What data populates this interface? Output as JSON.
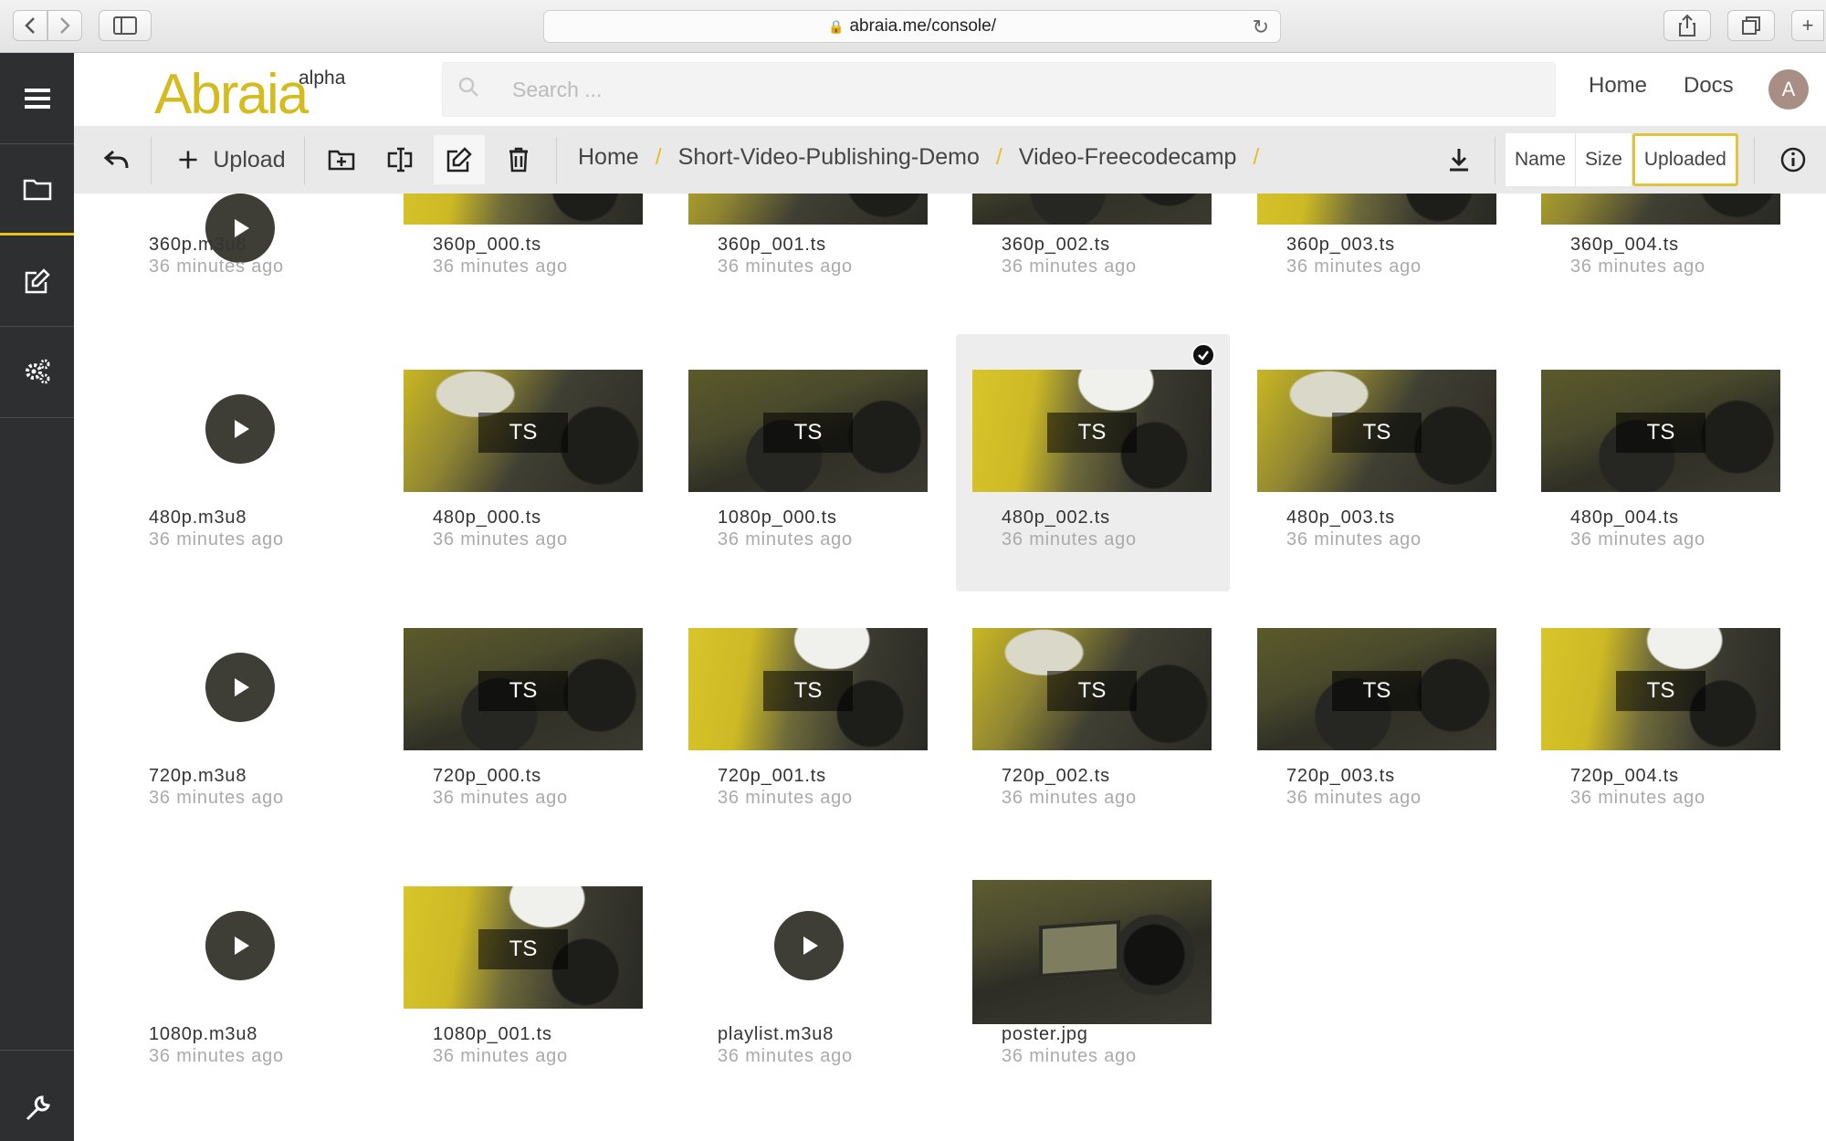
{
  "browser": {
    "url": "abraia.me/console/"
  },
  "header": {
    "logo": "Abraia",
    "logo_tag": "alpha",
    "search_placeholder": "Search ...",
    "links": [
      "Home",
      "Docs"
    ],
    "avatar_initial": "A"
  },
  "sidenav": {
    "items": [
      "menu",
      "files",
      "editor",
      "settings",
      "tools"
    ],
    "active": "files"
  },
  "toolbar": {
    "upload_label": "Upload",
    "breadcrumb": [
      "Home",
      "Short-Video-Publishing-Demo",
      "Video-Freecodecamp"
    ],
    "breadcrumb_separator": "/",
    "sort_options": [
      "Name",
      "Size",
      "Uploaded"
    ],
    "sort_selected": "Uploaded"
  },
  "files": [
    {
      "name": "360p.m3u8",
      "time": "36 minutes ago",
      "kind": "playlist"
    },
    {
      "name": "360p_000.ts",
      "time": "36 minutes ago",
      "kind": "ts"
    },
    {
      "name": "360p_001.ts",
      "time": "36 minutes ago",
      "kind": "ts"
    },
    {
      "name": "360p_002.ts",
      "time": "36 minutes ago",
      "kind": "ts"
    },
    {
      "name": "360p_003.ts",
      "time": "36 minutes ago",
      "kind": "ts"
    },
    {
      "name": "360p_004.ts",
      "time": "36 minutes ago",
      "kind": "ts"
    },
    {
      "name": "480p.m3u8",
      "time": "36 minutes ago",
      "kind": "playlist"
    },
    {
      "name": "480p_000.ts",
      "time": "36 minutes ago",
      "kind": "ts"
    },
    {
      "name": "1080p_000.ts",
      "time": "36 minutes ago",
      "kind": "ts"
    },
    {
      "name": "480p_002.ts",
      "time": "36 minutes ago",
      "kind": "ts",
      "selected": true
    },
    {
      "name": "480p_003.ts",
      "time": "36 minutes ago",
      "kind": "ts"
    },
    {
      "name": "480p_004.ts",
      "time": "36 minutes ago",
      "kind": "ts"
    },
    {
      "name": "720p.m3u8",
      "time": "36 minutes ago",
      "kind": "playlist"
    },
    {
      "name": "720p_000.ts",
      "time": "36 minutes ago",
      "kind": "ts"
    },
    {
      "name": "720p_001.ts",
      "time": "36 minutes ago",
      "kind": "ts"
    },
    {
      "name": "720p_002.ts",
      "time": "36 minutes ago",
      "kind": "ts"
    },
    {
      "name": "720p_003.ts",
      "time": "36 minutes ago",
      "kind": "ts"
    },
    {
      "name": "720p_004.ts",
      "time": "36 minutes ago",
      "kind": "ts"
    },
    {
      "name": "1080p.m3u8",
      "time": "36 minutes ago",
      "kind": "playlist"
    },
    {
      "name": "1080p_001.ts",
      "time": "36 minutes ago",
      "kind": "ts"
    },
    {
      "name": "playlist.m3u8",
      "time": "36 minutes ago",
      "kind": "playlist"
    },
    {
      "name": "poster.jpg",
      "time": "36 minutes ago",
      "kind": "image"
    }
  ],
  "ts_badge": "TS",
  "colors": {
    "brand_yellow": "#d4bb1f",
    "sidebar": "#2d2f30",
    "toolbar": "#e9e9e9",
    "play_button": "#3e3e37"
  }
}
